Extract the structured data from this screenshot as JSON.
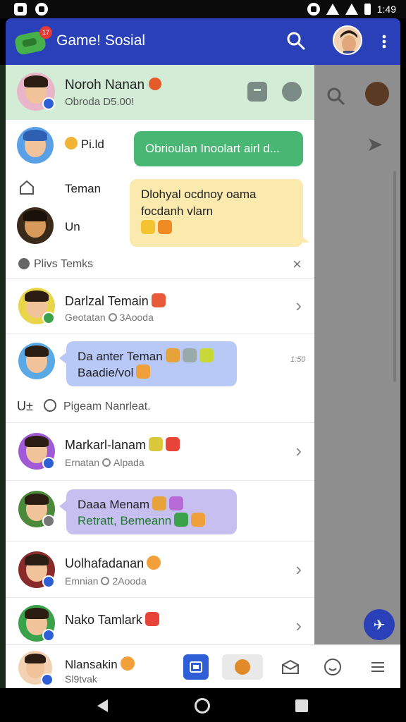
{
  "status_bar": {
    "time": "1:49",
    "icons": [
      "gallery-icon",
      "messenger-icon",
      "alarm-icon",
      "wifi-icon",
      "signal-icon",
      "battery-icon"
    ]
  },
  "app_bar": {
    "title": "Game! Sosial",
    "logo_badge": "17",
    "icons": [
      "game-logo-icon",
      "search-icon",
      "profile-avatar",
      "more-vert-icon"
    ]
  },
  "profile": {
    "name": "Noroh Nanan",
    "subtitle": "Obroda D5.00!",
    "icons": [
      "heart-badge-icon",
      "bag-icon",
      "edit-icon"
    ]
  },
  "nav_items": [
    {
      "label": "Pi.ld",
      "icon": "paw-icon"
    },
    {
      "label": "Teman",
      "icon": "home-icon"
    },
    {
      "label": "Un",
      "icon": "avatar"
    }
  ],
  "bubbles": {
    "green": "Obrioulan Inoolart airl d...",
    "yellow_line1": "Dlohyal ocdnoy oama",
    "yellow_line2": "focdanh vlarn"
  },
  "section_1": {
    "label": "Plivs Temks",
    "close": "×"
  },
  "rows": [
    {
      "name": "Darlzal Temain",
      "sub_a": "Geotatan",
      "sub_b": "3Aooda"
    },
    {
      "name": "Da anter Teman",
      "sub": "Baadie/vol",
      "type": "bubble"
    },
    {
      "name": "Markarl-lanam",
      "sub_a": "Ernatan",
      "sub_b": "Alpada"
    },
    {
      "name": "Daaa Menam",
      "sub": "Retratt, Bemeann",
      "type": "bubble"
    },
    {
      "name": "Uolhafadanan",
      "sub_a": "Emnian",
      "sub_b": "2Aooda"
    },
    {
      "name": "Nako Tamlark"
    }
  ],
  "side_note": "1:50",
  "section_2": {
    "label": "Pigeam Nanrleat.",
    "prefix": "U±"
  },
  "bottom_bar": {
    "name": "Nlansakin",
    "sub": "Sl9tvak",
    "nav": [
      "news-icon",
      "cookie-icon",
      "envelope-icon",
      "smiley-icon",
      "menu-icon"
    ]
  },
  "colors": {
    "app_bar": "#2a40b8",
    "profile_bg": "#d2ecd6",
    "green_bubble": "#48b774",
    "yellow_bubble": "#fbeaad",
    "blue_bubble": "#b9c9f7",
    "purple_bubble": "#c8bff1"
  }
}
